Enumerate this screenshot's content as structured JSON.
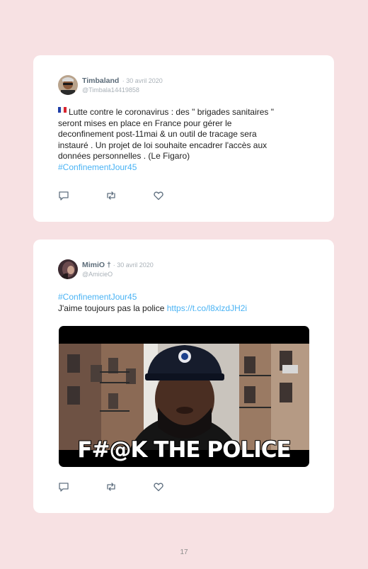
{
  "tweets": [
    {
      "name": "Timbaland",
      "date": "· 30 avril 2020",
      "handle": "@Timbala14419858",
      "flag_emoji": "🇫🇷",
      "text_lines": [
        "Lutte contre le coronavirus : des \" brigades sanitaires \"",
        "seront mises en place en France pour gérer le",
        "deconfinement post-11mai & un outil de tracage sera",
        "instauré . Un projet de loi souhaite encadrer l'accès aux",
        "données personnelles . (Le Figaro)"
      ],
      "hashtag": "#ConfinementJour45",
      "actions": [
        "reply-icon",
        "retweet-icon",
        "like-icon"
      ]
    },
    {
      "name": "MimiO † ",
      "date": "· 30 avril 2020",
      "handle": "@AmicieO",
      "hashtag": "#ConfinementJour45",
      "text": "J'aime toujours pas la police ",
      "link": "https://t.co/l8xlzdJH2i",
      "media_caption": "F#@K THE POLICE",
      "actions": [
        "reply-icon",
        "retweet-icon",
        "like-icon"
      ]
    }
  ],
  "page_number": "17",
  "colors": {
    "background": "#f7e1e3",
    "card": "#ffffff",
    "link": "#4ab3f4",
    "name": "#5b6b78",
    "muted": "#a9b1b8"
  }
}
